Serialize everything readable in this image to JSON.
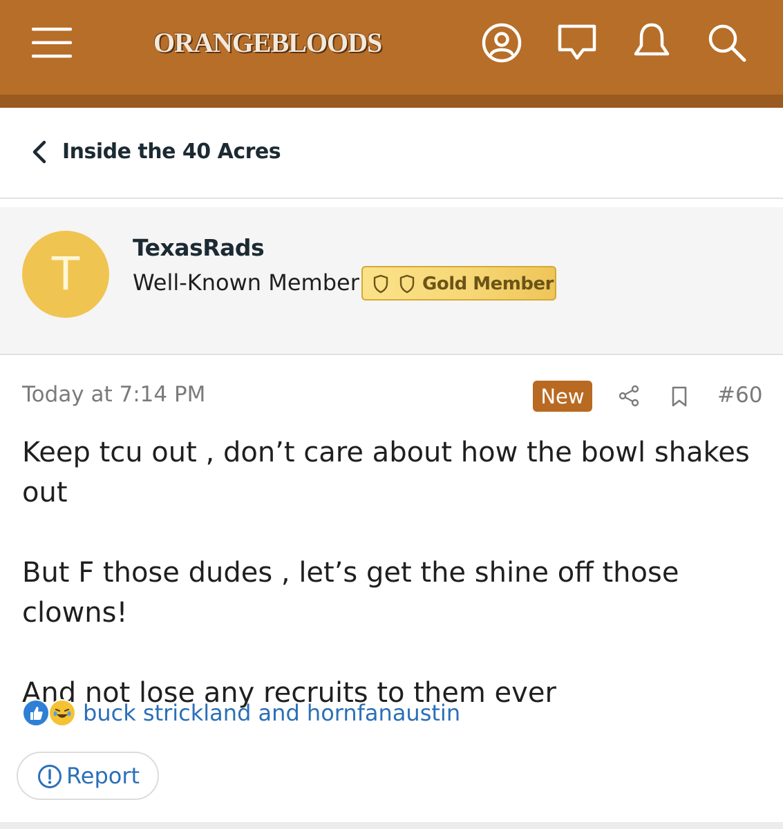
{
  "header": {
    "logo_text": "ORANGEBLOODS",
    "menu_icon": "hamburger-menu-icon",
    "account_icon": "user-circle-icon",
    "messages_icon": "chat-bubble-icon",
    "alerts_icon": "bell-icon",
    "search_icon": "search-icon",
    "bar_color": "#b76e28"
  },
  "breadcrumb": {
    "label": "Inside the 40 Acres",
    "icon": "chevron-left-icon"
  },
  "author": {
    "avatar_letter": "T",
    "avatar_color": "#f0c451",
    "username": "TexasRads",
    "user_title": "Well-Known Member",
    "badge_label": "Gold Member",
    "badge_icons": [
      "shield-icon",
      "shield-icon"
    ]
  },
  "post": {
    "date": "Today at 7:14 PM",
    "new_label": "New",
    "share_icon": "share-icon",
    "bookmark_icon": "bookmark-icon",
    "post_number": "#60",
    "paragraphs": [
      "Keep tcu out , don’t care about how the bowl shakes out",
      "But F those dudes , let’s get the shine off those clowns!",
      "And not lose any recruits to them ever"
    ]
  },
  "reactions": {
    "icons": [
      "thumbs-up-icon",
      "laughing-emoji-icon"
    ],
    "names": "buck strickland and hornfanaustin"
  },
  "actions": {
    "report_label": "Report",
    "report_icon": "exclamation-circle-icon"
  }
}
